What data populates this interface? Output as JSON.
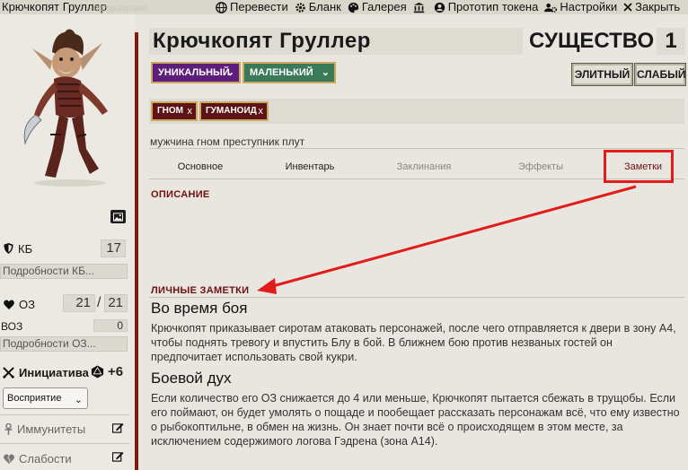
{
  "topbar": {
    "title": "Крючкопят Груллер",
    "ghost_text": "предыдущие",
    "actions": [
      {
        "label": "Перевести",
        "icon": "globe-icon"
      },
      {
        "label": "Бланк",
        "icon": "gear-icon"
      },
      {
        "label": "Галерея",
        "icon": "palette-icon"
      },
      {
        "label": "",
        "icon": "temple-icon"
      },
      {
        "label": "Прототип токена",
        "icon": "user-circle-icon"
      },
      {
        "label": "Настройки",
        "icon": "users-cog-icon"
      },
      {
        "label": "Закрыть",
        "icon": "close-icon"
      }
    ]
  },
  "sidebar": {
    "ac": {
      "label": "КБ",
      "value": "17",
      "details_placeholder": "Подробности КБ..."
    },
    "hp": {
      "label": "ОЗ",
      "value": "21",
      "max": "21",
      "temp_label": "ВОЗ",
      "temp_value": "0",
      "details_placeholder": "Подробности ОЗ..."
    },
    "initiative": {
      "label": "Инициатива",
      "value": "+6",
      "skill": "Восприятие"
    },
    "immunities_label": "Иммунитеты",
    "weaknesses_label": "Слабости"
  },
  "header": {
    "name": "Крючкопят Груллер",
    "type_label": "СУЩЕСТВО",
    "level": "1",
    "rarity": "УНИКАЛЬНЫЙ",
    "size": "МАЛЕНЬКИЙ",
    "elite_label": "ЭЛИТНЫЙ",
    "weak_label": "СЛАБЫЙ",
    "traits": [
      "ГНОМ",
      "ГУМАНОИД"
    ],
    "blurb": "мужчина гном преступник плут"
  },
  "tabs": [
    {
      "label": "Основное",
      "state": "normal"
    },
    {
      "label": "Инвентарь",
      "state": "normal"
    },
    {
      "label": "Заклинания",
      "state": "dim"
    },
    {
      "label": "Эффекты",
      "state": "dim"
    },
    {
      "label": "Заметки",
      "state": "active"
    }
  ],
  "notes": {
    "description_title": "ОПИСАНИЕ",
    "private_title": "ЛИЧНЫЕ ЗАМЕТКИ",
    "sections": [
      {
        "heading": "Во время боя",
        "text": "Крючкопят приказывает сиротам атаковать персонажей, после чего отправляется к двери в зону А4, чтобы поднять тревогу и впустить Блу в бой. В ближнем бою против незваных гостей он предпочитает использовать свой кукри."
      },
      {
        "heading": "Боевой дух",
        "text": "Если количество его ОЗ снижается до 4 или меньше, Крючкопят пытается сбежать в трущобы. Если его поймают, он будет умолять о пощаде и пообещает рассказать персонажам всё, что ему известно о рыбокоптильне, в обмен на жизнь. Он знает почти всё о происходящем в этом месте, за исключением содержимого логова Гэдрена (зона А14)."
      }
    ]
  },
  "colors": {
    "accent_red": "#6d1111",
    "rarity_purple": "#5d1d7a",
    "size_green": "#3a7a59",
    "highlight_red": "#e21b1b"
  }
}
